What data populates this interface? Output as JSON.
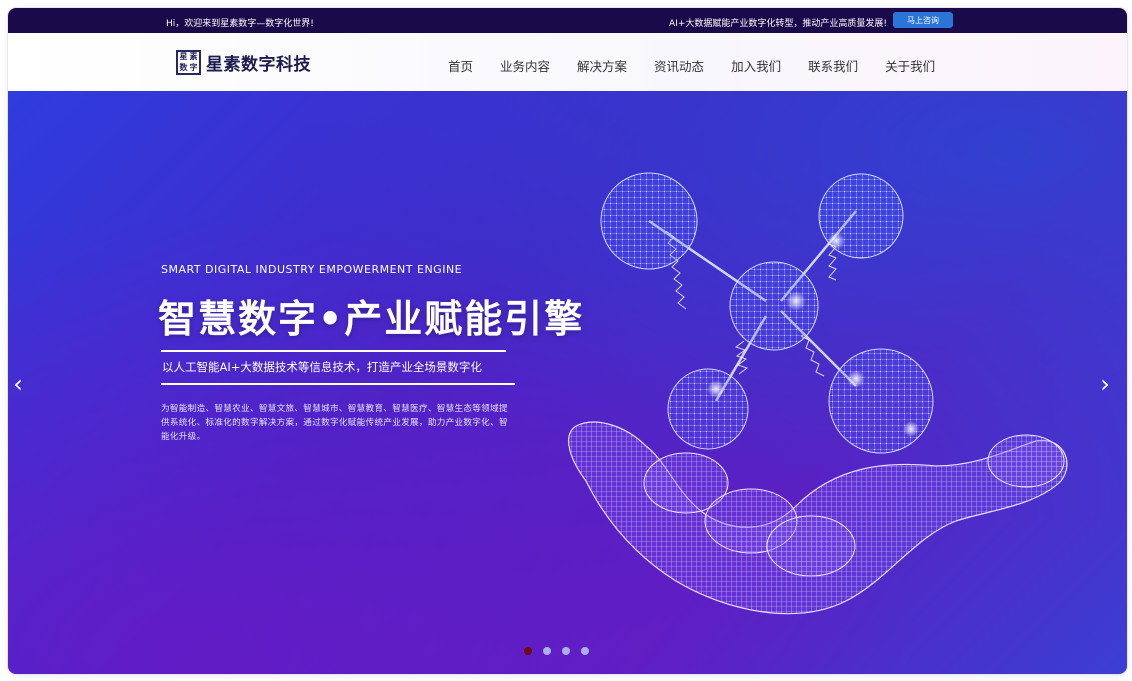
{
  "topbar": {
    "greeting": "Hi，欢迎来到星素数字—数字化世界!",
    "slogan": "AI+大数据赋能产业数字化转型，推动产业高质量发展!",
    "consult_label": "马上咨询"
  },
  "header": {
    "logo_mark": [
      "星",
      "素",
      "数",
      "字"
    ],
    "brand": "星素数字科技",
    "nav": [
      "首页",
      "业务内容",
      "解决方案",
      "资讯动态",
      "加入我们",
      "联系我们",
      "关于我们"
    ]
  },
  "hero": {
    "subtitle": "SMART DIGITAL INDUSTRY EMPOWERMENT ENGINE",
    "title": "智慧数字•产业赋能引擎",
    "tagline": "以人工智能AI+大数据技术等信息技术，打造产业全场景数字化",
    "description": "为智能制造、智慧农业、智慧文旅、智慧城市、智慧教育、智慧医疗、智慧生态等领域提供系统化、标准化的数字解决方案，通过数字化赋能传统产业发展，助力产业数字化、智能化升级。",
    "arrow_left": "‹",
    "arrow_right": "›",
    "slides_total": 4,
    "slide_active": 1
  },
  "colors": {
    "topbar_bg": "#1a0a4a",
    "consult_button": "#2a76d8",
    "brand_text": "#1e1b4f",
    "hero_primary": "#4626c6",
    "dot_active": "#6a0a1a"
  }
}
